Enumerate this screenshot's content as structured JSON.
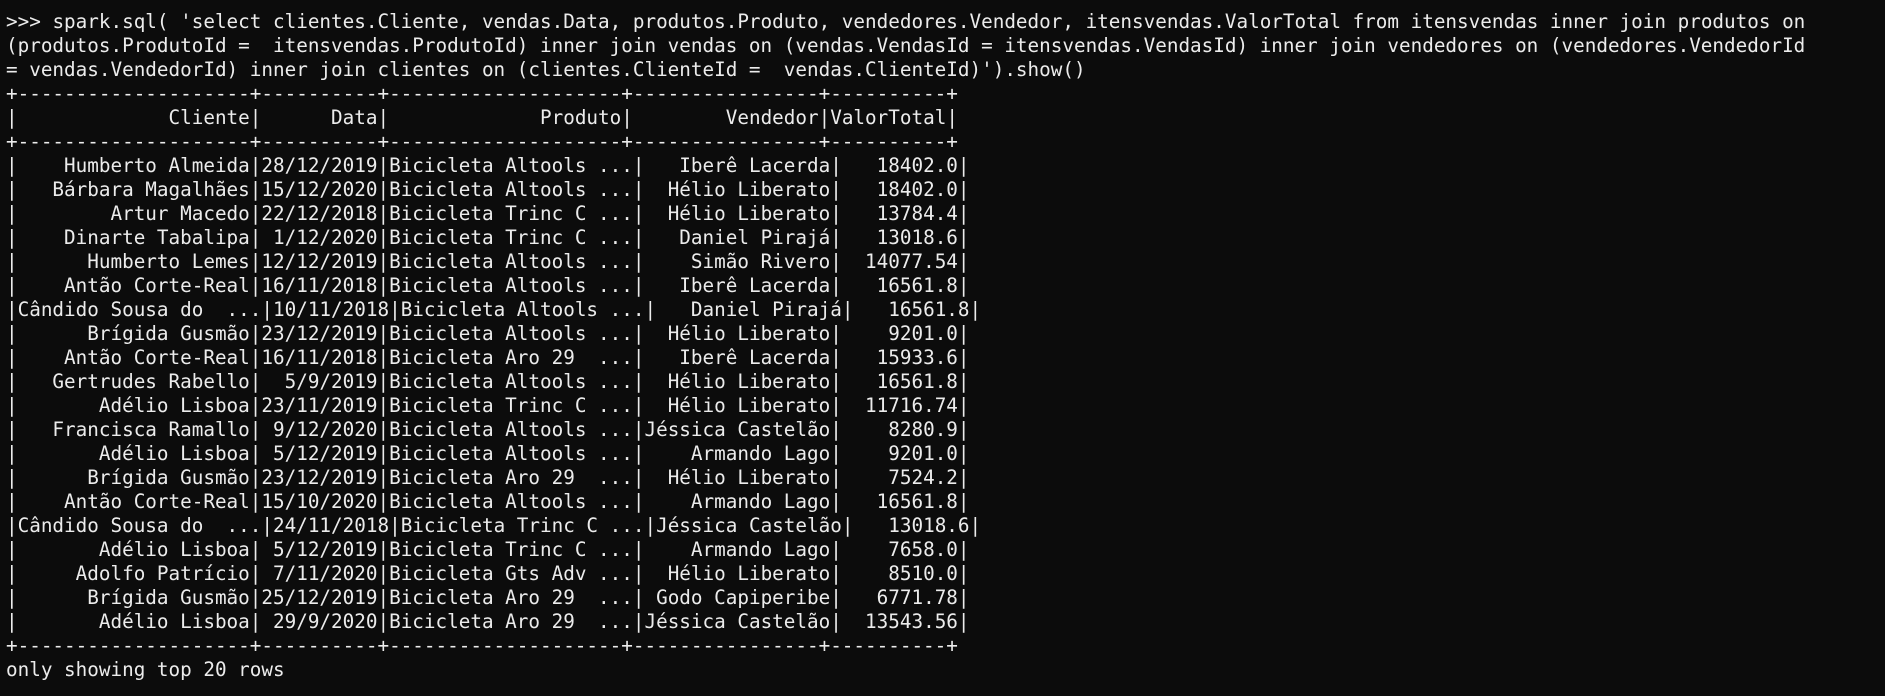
{
  "prompt": ">>> ",
  "command_lines": [
    "spark.sql( 'select clientes.Cliente, vendas.Data, produtos.Produto, vendedores.Vendedor, itensvendas.ValorTotal from itensvendas inner join produtos on",
    "(produtos.ProdutoId =  itensvendas.ProdutoId) inner join vendas on (vendas.VendasId = itensvendas.VendasId) inner join vendedores on (vendedores.VendedorId",
    "= vendas.VendedorId) inner join clientes on (clientes.ClienteId =  vendas.ClienteId)').show()"
  ],
  "table": {
    "columns": [
      {
        "name": "Cliente",
        "width": 20
      },
      {
        "name": "Data",
        "width": 10
      },
      {
        "name": "Produto",
        "width": 20
      },
      {
        "name": "Vendedor",
        "width": 16
      },
      {
        "name": "ValorTotal",
        "width": 10
      }
    ],
    "rows": [
      [
        "Humberto Almeida",
        "28/12/2019",
        "Bicicleta Altools ...",
        "Iberê Lacerda",
        "18402.0"
      ],
      [
        "Bárbara Magalhães",
        "15/12/2020",
        "Bicicleta Altools ...",
        "Hélio Liberato",
        "18402.0"
      ],
      [
        "Artur Macedo",
        "22/12/2018",
        "Bicicleta Trinc C ...",
        "Hélio Liberato",
        "13784.4"
      ],
      [
        "Dinarte Tabalipa",
        "1/12/2020",
        "Bicicleta Trinc C ...",
        "Daniel Pirajá",
        "13018.6"
      ],
      [
        "Humberto Lemes",
        "12/12/2019",
        "Bicicleta Altools ...",
        "Simão Rivero",
        "14077.54"
      ],
      [
        "Antão Corte-Real",
        "16/11/2018",
        "Bicicleta Altools ...",
        "Iberê Lacerda",
        "16561.8"
      ],
      [
        "Cândido Sousa do  ...",
        "10/11/2018",
        "Bicicleta Altools ...",
        "Daniel Pirajá",
        "16561.8"
      ],
      [
        "Brígida Gusmão",
        "23/12/2019",
        "Bicicleta Altools ...",
        "Hélio Liberato",
        "9201.0"
      ],
      [
        "Antão Corte-Real",
        "16/11/2018",
        "Bicicleta Aro 29  ...",
        "Iberê Lacerda",
        "15933.6"
      ],
      [
        "Gertrudes Rabello",
        "5/9/2019",
        "Bicicleta Altools ...",
        "Hélio Liberato",
        "16561.8"
      ],
      [
        "Adélio Lisboa",
        "23/11/2019",
        "Bicicleta Trinc C ...",
        "Hélio Liberato",
        "11716.74"
      ],
      [
        "Francisca Ramallo",
        "9/12/2020",
        "Bicicleta Altools ...",
        "Jéssica Castelão",
        "8280.9"
      ],
      [
        "Adélio Lisboa",
        "5/12/2019",
        "Bicicleta Altools ...",
        "Armando Lago",
        "9201.0"
      ],
      [
        "Brígida Gusmão",
        "23/12/2019",
        "Bicicleta Aro 29  ...",
        "Hélio Liberato",
        "7524.2"
      ],
      [
        "Antão Corte-Real",
        "15/10/2020",
        "Bicicleta Altools ...",
        "Armando Lago",
        "16561.8"
      ],
      [
        "Cândido Sousa do  ...",
        "24/11/2018",
        "Bicicleta Trinc C ...",
        "Jéssica Castelão",
        "13018.6"
      ],
      [
        "Adélio Lisboa",
        "5/12/2019",
        "Bicicleta Trinc C ...",
        "Armando Lago",
        "7658.0"
      ],
      [
        "Adolfo Patrício",
        "7/11/2020",
        "Bicicleta Gts Adv ...",
        "Hélio Liberato",
        "8510.0"
      ],
      [
        "Brígida Gusmão",
        "25/12/2019",
        "Bicicleta Aro 29  ...",
        "Godo Capiperibe",
        "6771.78"
      ],
      [
        "Adélio Lisboa",
        "29/9/2020",
        "Bicicleta Aro 29  ...",
        "Jéssica Castelão",
        "13543.56"
      ]
    ]
  },
  "footer": "only showing top 20 rows",
  "colors": {
    "background": "#0c0c0c",
    "foreground": "#ececec"
  }
}
